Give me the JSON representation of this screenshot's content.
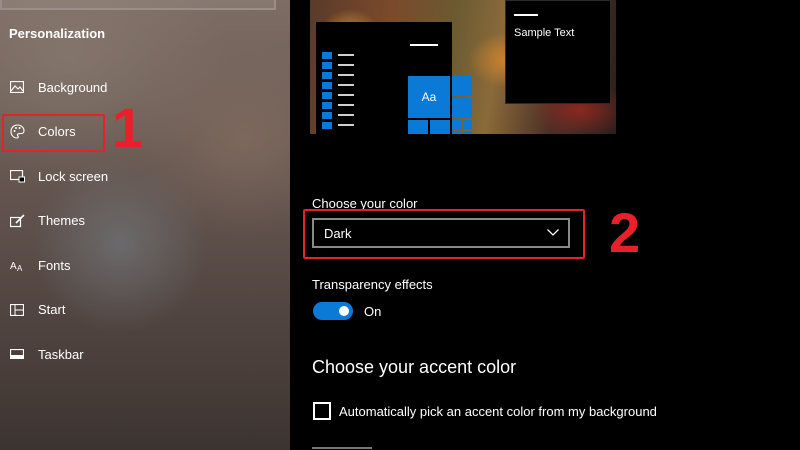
{
  "sidebar": {
    "section_title": "Personalization",
    "items": [
      {
        "label": "Background",
        "icon": "picture-icon"
      },
      {
        "label": "Colors",
        "icon": "palette-icon",
        "selected": true
      },
      {
        "label": "Lock screen",
        "icon": "lock-screen-icon"
      },
      {
        "label": "Themes",
        "icon": "brush-icon"
      },
      {
        "label": "Fonts",
        "icon": "fonts-icon"
      },
      {
        "label": "Start",
        "icon": "start-grid-icon"
      },
      {
        "label": "Taskbar",
        "icon": "taskbar-icon"
      }
    ]
  },
  "annotations": {
    "step1": "1",
    "step2": "2",
    "color": "#e8202a"
  },
  "preview": {
    "tile_label": "Aa",
    "sample_text": "Sample Text"
  },
  "color_mode": {
    "label": "Choose your color",
    "selected": "Dark"
  },
  "transparency": {
    "label": "Transparency effects",
    "state": "On",
    "enabled": true
  },
  "accent": {
    "heading": "Choose your accent color",
    "auto_pick_label": "Automatically pick an accent color from my background",
    "auto_pick_checked": false,
    "color": "#0a7ad6"
  }
}
